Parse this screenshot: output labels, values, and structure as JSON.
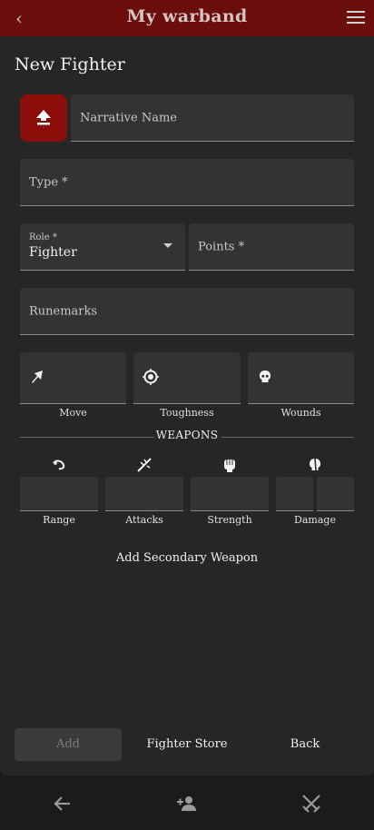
{
  "header": {
    "title": "My warband",
    "back_icon": "chevron-left-icon",
    "menu_icon": "hamburger-menu-icon"
  },
  "form": {
    "heading": "New Fighter",
    "narrative_name_placeholder": "Narrative Name",
    "type_label": "Type *",
    "role_label": "Role *",
    "role_value": "Fighter",
    "points_label": "Points *",
    "runemarks_label": "Runemarks"
  },
  "stats": {
    "move": "Move",
    "toughness": "Toughness",
    "wounds": "Wounds"
  },
  "weapons": {
    "title": "WEAPONS",
    "range": "Range",
    "attacks": "Attacks",
    "strength": "Strength",
    "damage": "Damage",
    "add_secondary": "Add Secondary Weapon"
  },
  "actions": {
    "add": "Add",
    "fighter_store": "Fighter Store",
    "back": "Back"
  },
  "bottom_nav": {
    "icons": [
      "arrow-back-icon",
      "add-person-icon",
      "crossed-swords-icon"
    ]
  },
  "colors": {
    "header": "#6b0d0a",
    "upload_button": "#8a0f0a",
    "panel": "#262626",
    "field": "#333333"
  }
}
